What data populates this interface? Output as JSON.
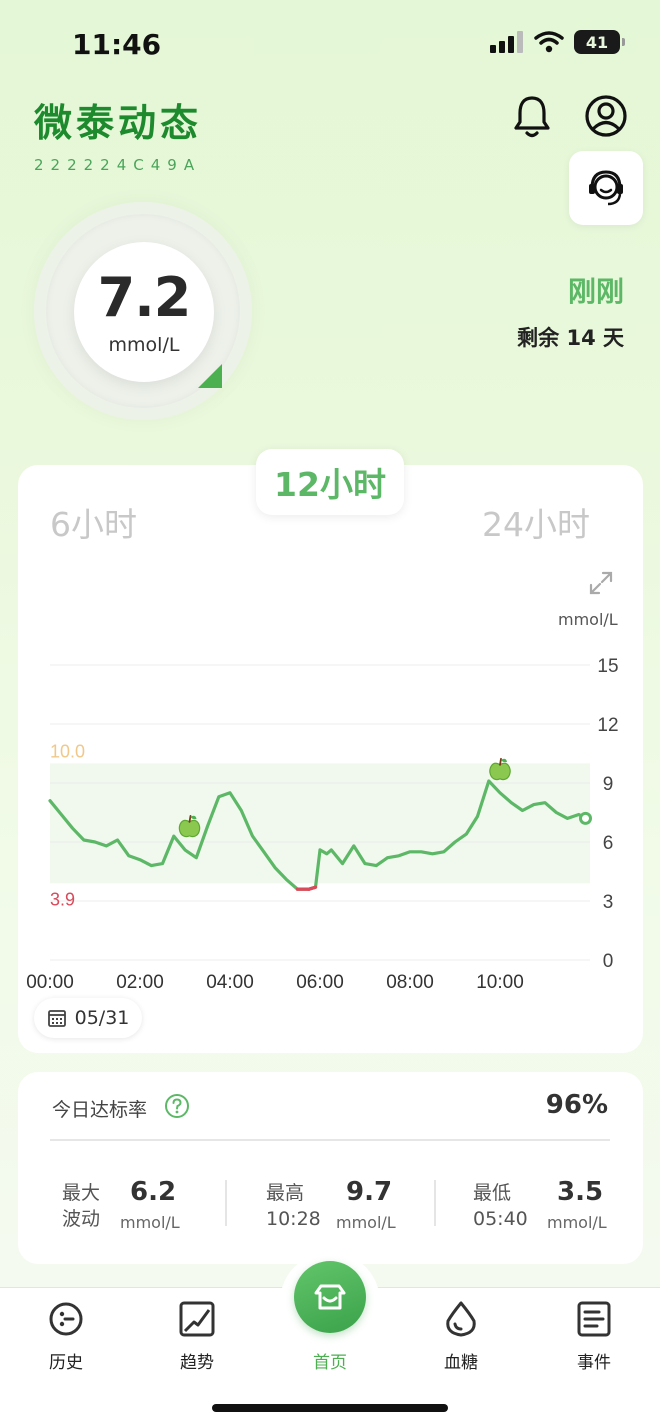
{
  "status_bar": {
    "time": "11:46",
    "battery": "41"
  },
  "header": {
    "title": "微泰动态",
    "device_id": "222224C49A"
  },
  "reading": {
    "value": "7.2",
    "unit": "mmol/L",
    "updated": "刚刚",
    "remaining": "剩余 14 天"
  },
  "tabs": {
    "h6": "6小时",
    "h12": "12小时",
    "h24": "24小时",
    "selected": "12小时"
  },
  "chart": {
    "unit_label": "mmol/L",
    "date": "05/31",
    "high_label": "10.0",
    "low_label": "3.9"
  },
  "chart_data": {
    "type": "line",
    "title": "",
    "xlabel": "",
    "ylabel": "mmol/L",
    "xlim": [
      0,
      12
    ],
    "ylim": [
      0,
      15
    ],
    "y_ticks": [
      "15",
      "12",
      "9",
      "6",
      "3",
      "0"
    ],
    "x_ticks": [
      "00:00",
      "02:00",
      "04:00",
      "06:00",
      "08:00",
      "10:00"
    ],
    "target_range": [
      3.9,
      10.0
    ],
    "series": [
      {
        "x": [
          0,
          0.25,
          0.5,
          0.75,
          1.0,
          1.25,
          1.5,
          1.75,
          2.0,
          2.25,
          2.5,
          2.75,
          3.0,
          3.25,
          3.5,
          3.75,
          4.0,
          4.25,
          4.5,
          4.75,
          5.0,
          5.25,
          5.5,
          5.75,
          5.9,
          6.0,
          6.15,
          6.25,
          6.5,
          6.75,
          7.0,
          7.25,
          7.5,
          7.75,
          8.0,
          8.25,
          8.5,
          8.75,
          9.0,
          9.25,
          9.5,
          9.75,
          10.0,
          10.25,
          10.5,
          10.75,
          11.0,
          11.25,
          11.5,
          11.75,
          11.9
        ],
        "values": [
          8.1,
          7.4,
          6.7,
          6.1,
          6.0,
          5.8,
          6.1,
          5.3,
          5.1,
          4.8,
          4.9,
          6.3,
          5.6,
          5.2,
          6.8,
          8.3,
          8.5,
          7.6,
          6.3,
          5.5,
          4.7,
          4.1,
          3.6,
          3.6,
          3.7,
          5.6,
          5.4,
          5.6,
          4.9,
          5.8,
          4.9,
          4.8,
          5.2,
          5.3,
          5.5,
          5.5,
          5.4,
          5.5,
          6.0,
          6.4,
          7.3,
          9.1,
          8.5,
          8.0,
          7.6,
          7.9,
          8.0,
          7.5,
          7.2,
          7.4,
          7.2
        ]
      }
    ],
    "meal_markers_x": [
      3.1,
      10.0
    ]
  },
  "stats": {
    "rate_label": "今日达标率",
    "rate_value": "96%",
    "max_fluct_label_1": "最大",
    "max_fluct_label_2": "波动",
    "max_fluct_value": "6.2",
    "max_fluct_unit": "mmol/L",
    "high_label": "最高",
    "high_time": "10:28",
    "high_value": "9.7",
    "high_unit": "mmol/L",
    "low_label": "最低",
    "low_time": "05:40",
    "low_value": "3.5",
    "low_unit": "mmol/L"
  },
  "nav": {
    "history": "历史",
    "trend": "趋势",
    "home": "首页",
    "glucose": "血糖",
    "events": "事件",
    "active": "首页"
  },
  "colors": {
    "accent": "#5cb866",
    "brand": "#1e8a2e",
    "low": "#d94a5a",
    "high": "#f0c98a"
  }
}
